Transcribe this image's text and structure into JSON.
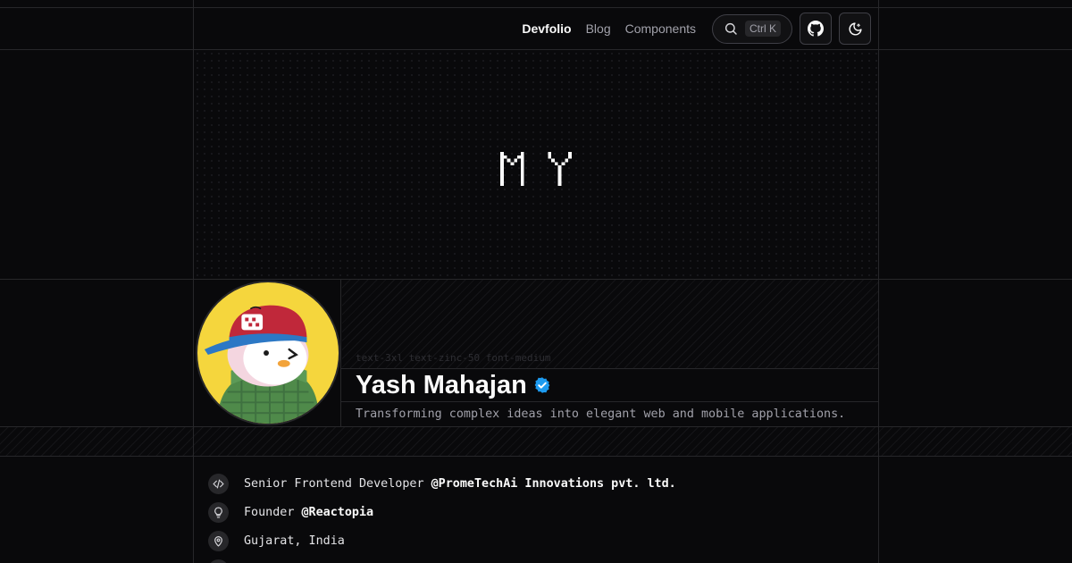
{
  "nav": {
    "links": [
      {
        "label": "Devfolio",
        "active": true
      },
      {
        "label": "Blog",
        "active": false
      },
      {
        "label": "Components",
        "active": false
      }
    ],
    "search_shortcut": "Ctrl K",
    "github_icon": "github-icon",
    "theme_icon": "moon-icon"
  },
  "hero": {
    "pixel_text": "MY"
  },
  "profile": {
    "code_hint": "text-3xl text-zinc-50 font-medium",
    "name": "Yash Mahajan",
    "tagline": "Transforming complex ideas into elegant web and mobile applications.",
    "verified_color": "#1d9bf0"
  },
  "info": [
    {
      "icon": "code-icon",
      "prefix": "Senior Frontend Developer ",
      "highlight": "@PromeTechAi Innovations pvt. ltd."
    },
    {
      "icon": "lightbulb-icon",
      "prefix": "Founder ",
      "highlight": "@Reactopia"
    },
    {
      "icon": "map-pin-icon",
      "prefix": "Gujarat, India",
      "highlight": ""
    }
  ],
  "colors": {
    "background": "#09090b",
    "border": "#27272a",
    "text": "#fafafa",
    "muted": "#a1a1aa"
  }
}
